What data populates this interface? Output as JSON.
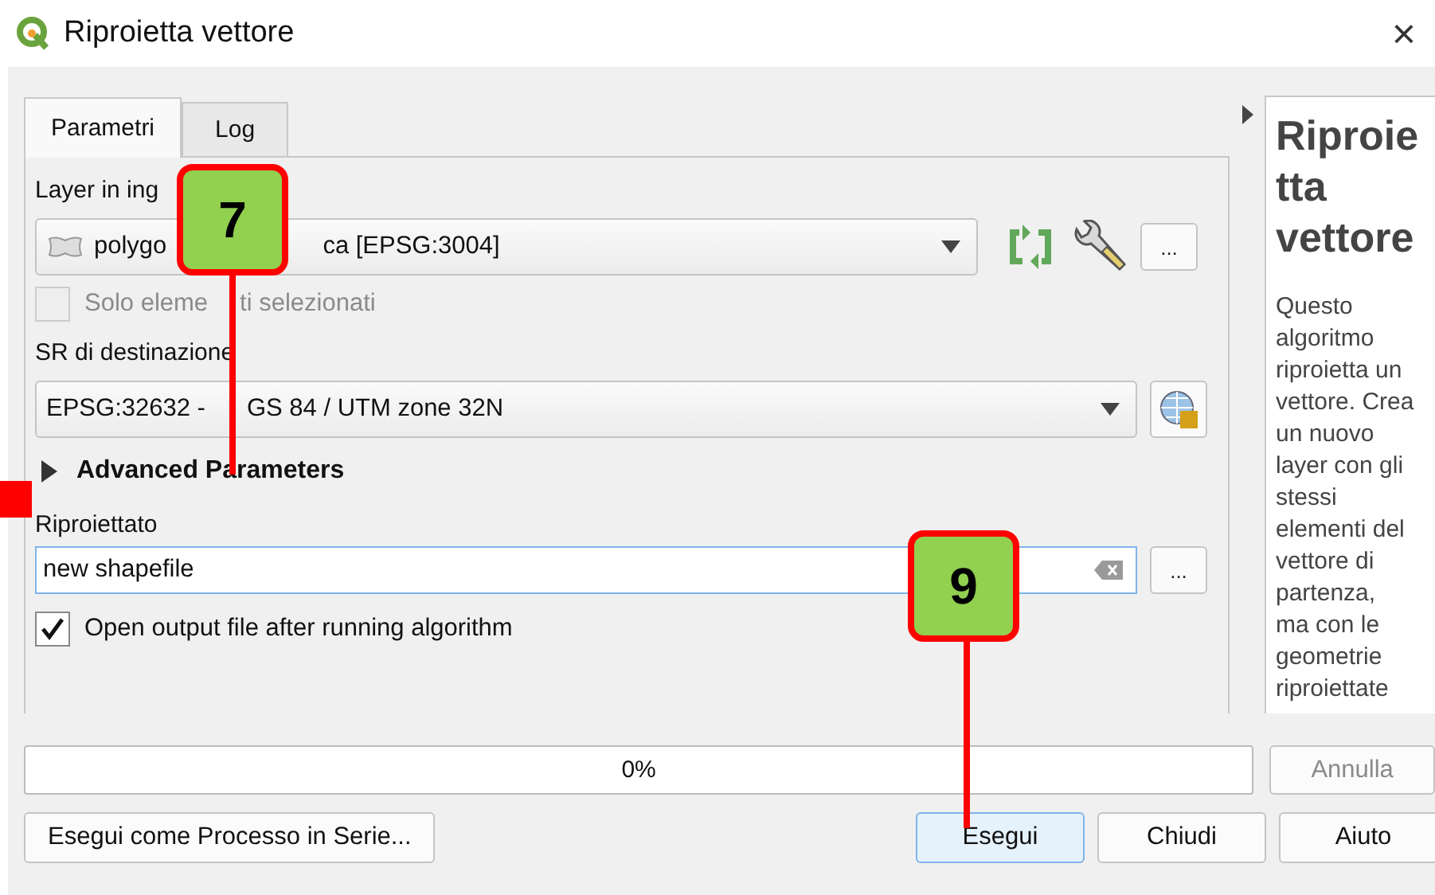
{
  "window": {
    "title": "Riproietta vettore",
    "close": "×"
  },
  "tabs": [
    {
      "label": "Parametri",
      "selected": true
    },
    {
      "label": "Log",
      "selected": false
    }
  ],
  "form": {
    "layer_label": "Layer in ing",
    "layer_value_parts": [
      "polygo",
      "ca [EPSG:3004]"
    ],
    "more_button": "...",
    "selected_only": {
      "label_parts": [
        "Solo eleme",
        "ti selezionati"
      ],
      "checked": false,
      "disabled": true
    },
    "crs_label": "SR di destinazione",
    "crs_value_parts": [
      "EPSG:32632 -",
      "GS 84 / UTM zone 32N"
    ],
    "advanced": {
      "label": "Advanced Parameters",
      "expanded": false
    },
    "output_label": "Riproiettato",
    "output_value": "new shapefile",
    "output_more": "...",
    "open_output": {
      "label": "Open output file after running algorithm",
      "checked": true
    }
  },
  "help": {
    "title_lines": [
      "Riproie",
      "tta",
      "vettore"
    ],
    "body_lines": [
      "Questo",
      "algoritmo",
      "riproietta un",
      "vettore. Crea",
      "un nuovo",
      "layer con gli",
      "stessi",
      "elementi del",
      "vettore di",
      "partenza,",
      "ma con le",
      "geometrie",
      "riproiettate"
    ]
  },
  "progress": {
    "level": 0,
    "text": "0%"
  },
  "buttons": [
    {
      "label": "Annulla",
      "disabled": true,
      "kind": "cancel"
    },
    {
      "label": "Esegui come Processo in Serie...",
      "disabled": false,
      "kind": "batch"
    },
    {
      "label": "Esegui",
      "disabled": false,
      "kind": "default"
    },
    {
      "label": "Chiudi",
      "disabled": false,
      "kind": "normal"
    },
    {
      "label": "Aiuto",
      "disabled": false,
      "kind": "normal"
    }
  ],
  "callouts": [
    {
      "label": "7"
    },
    {
      "label": "9"
    }
  ]
}
